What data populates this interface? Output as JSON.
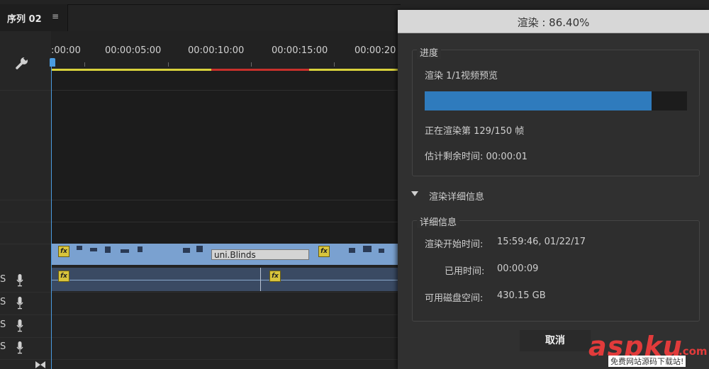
{
  "timeline": {
    "tab_title": "序列 02",
    "menu_icon": "≡",
    "tool_icon": "wrench-icon",
    "ruler_timecodes": [
      ":00:00",
      "00:00:05:00",
      "00:00:10:00",
      "00:00:15:00",
      "00:00:20"
    ],
    "transition_label": "uni.Blinds",
    "fx_badge": "fx",
    "track_label": "S",
    "track_icon": "microphone-icon",
    "workarea_colors": {
      "rendered_partial": "#d9d23b",
      "unrendered": "#c8302b"
    }
  },
  "dialog": {
    "title": "渲染 : 86.40%",
    "progress_group_label": "进度",
    "render_label": "渲染 1/1视频预览",
    "progress_fraction": 0.864,
    "frame_status": "正在渲染第 129/150 帧",
    "remaining_label": "估计剩余时间: 00:00:01",
    "details_toggle_label": "渲染详细信息",
    "details_group_label": "详细信息",
    "details": [
      {
        "label": "渲染开始时间:",
        "value": "15:59:46, 01/22/17"
      },
      {
        "label": "已用时间:",
        "value": "00:00:09"
      },
      {
        "label": "可用磁盘空间:",
        "value": "430.15 GB"
      }
    ],
    "cancel_label": "取消",
    "accent_color": "#2f7bbd"
  },
  "watermark": {
    "brand": "aspku",
    "suffix": ".com",
    "tagline": "免费网站源码下载站!"
  }
}
